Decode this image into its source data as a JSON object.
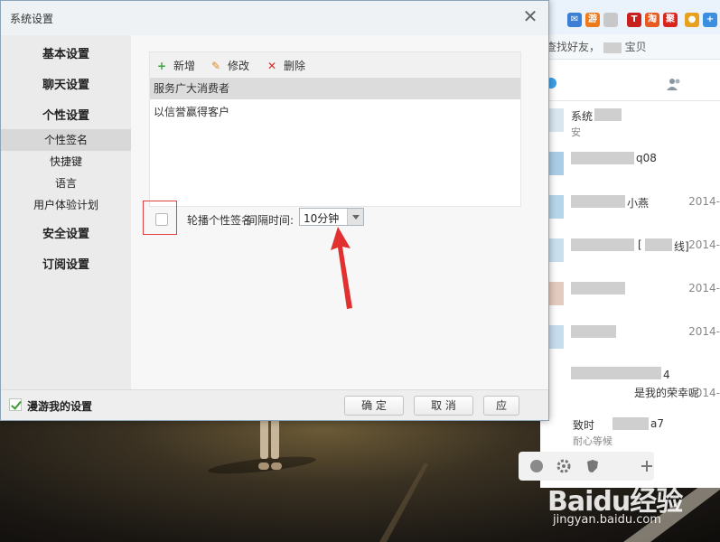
{
  "dialog": {
    "title": "系统设置",
    "close_label": "✕"
  },
  "sidebar": {
    "items": [
      {
        "label": "基本设置"
      },
      {
        "label": "聊天设置"
      },
      {
        "label": "个性设置"
      },
      {
        "label": "个性签名"
      },
      {
        "label": "快捷键"
      },
      {
        "label": "语言"
      },
      {
        "label": "用户体验计划"
      },
      {
        "label": "安全设置"
      },
      {
        "label": "订阅设置"
      }
    ]
  },
  "toolbar": {
    "add_label": "新增",
    "add_icon": "+",
    "edit_label": "修改",
    "edit_icon": "✎",
    "delete_label": "删除",
    "delete_icon": "✕"
  },
  "signatures": [
    {
      "text": "服务广大消费者"
    },
    {
      "text": "以信誉赢得客户"
    }
  ],
  "rotate": {
    "label": "轮播个性签名",
    "interval_label": "间隔时间:",
    "interval_value": "10分钟"
  },
  "footer": {
    "roam_label": "漫游我的设置",
    "ok_label": "确 定",
    "cancel_label": "取 消",
    "apply_label": "应"
  },
  "im": {
    "search_placeholder": "查找好友，",
    "search_suffix": "宝贝",
    "contacts": [
      {
        "name": "系统",
        "sub": "安",
        "date": ""
      },
      {
        "name": "q08",
        "sub": "",
        "date": ""
      },
      {
        "name": "小燕",
        "sub": "",
        "date": "2014-"
      },
      {
        "name": "[",
        "sub": "线]",
        "date": "2014-"
      },
      {
        "name": "",
        "sub": "",
        "date": "2014-"
      },
      {
        "name": "",
        "sub": "",
        "date": "2014-"
      },
      {
        "name": "4",
        "sub": "是我的荣幸呢",
        "date": "2014-"
      },
      {
        "name": "致时",
        "sub": "耐心等候",
        "date": ""
      },
      {
        "name": "a7",
        "sub": "",
        "date": ""
      }
    ]
  },
  "watermark": {
    "logo": "Baidu经验",
    "url": "jingyan.baidu.com"
  },
  "colors": {
    "accent_red": "#e04040",
    "check_green": "#3a9b33",
    "add_green": "#3aa33a",
    "edit_orange": "#e08a1e",
    "delete_red": "#d92a2a"
  }
}
